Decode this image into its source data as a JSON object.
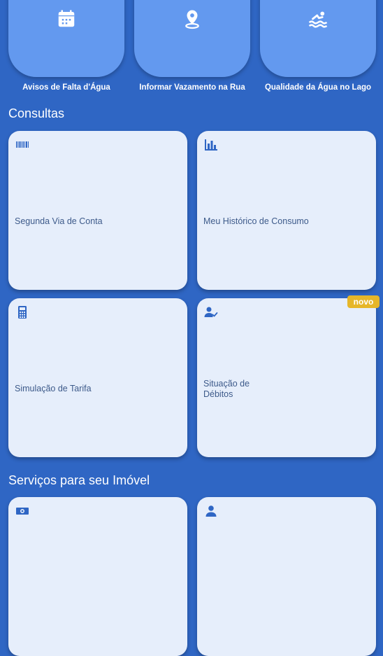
{
  "quick_actions": [
    {
      "label": "Avisos de Falta d'Água",
      "icon": "calendar-icon"
    },
    {
      "label": "Informar Vazamento na Rua",
      "icon": "location-pin-icon"
    },
    {
      "label": "Qualidade da Água no Lago",
      "icon": "swimming-icon"
    }
  ],
  "consultas": {
    "title": "Consultas",
    "cards": [
      {
        "label": "Segunda Via de Conta",
        "icon": "barcode-icon"
      },
      {
        "label": "Meu Histórico de Consumo",
        "icon": "bar-chart-icon"
      },
      {
        "label": "Simulação de Tarifa",
        "icon": "calculator-icon"
      },
      {
        "label": "Situação de\nDébitos",
        "icon": "person-check-icon",
        "badge": "novo"
      }
    ]
  },
  "servicos": {
    "title": "Serviços para seu Imóvel",
    "cards": [
      {
        "icon": "money-icon"
      },
      {
        "icon": "person-icon"
      }
    ]
  },
  "colors": {
    "background": "#2f66c4",
    "pill": "#6399ef",
    "card": "#e6eefb",
    "badge": "#e6b629",
    "icon": "#2f66c4"
  }
}
